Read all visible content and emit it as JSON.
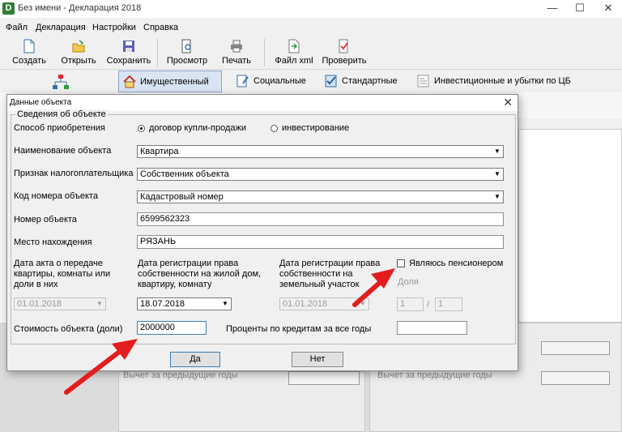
{
  "window": {
    "title": "Без имени - Декларация 2018",
    "app_icon": "D",
    "controls": [
      "—",
      "☐",
      "✕"
    ]
  },
  "menu": [
    "Файл",
    "Декларация",
    "Настройки",
    "Справка"
  ],
  "toolbar": [
    {
      "label": "Создать",
      "icon": "new-file-icon"
    },
    {
      "label": "Открыть",
      "icon": "open-folder-icon"
    },
    {
      "label": "Сохранить",
      "icon": "save-disk-icon"
    },
    {
      "label": "Просмотр",
      "icon": "preview-icon"
    },
    {
      "label": "Печать",
      "icon": "printer-icon"
    },
    {
      "label": "Файл xml",
      "icon": "xml-file-icon"
    },
    {
      "label": "Проверить",
      "icon": "check-document-icon"
    }
  ],
  "category_tabs": [
    {
      "label": "Имущественный",
      "icon": "house-icon",
      "active": true
    },
    {
      "label": "Социальные",
      "icon": "document-pen-icon"
    },
    {
      "label": "Стандартные",
      "icon": "checklist-icon"
    },
    {
      "label": "Инвестиционные и убытки по ЦБ",
      "icon": "investment-icon"
    }
  ],
  "background": {
    "deduction_prev_years_1": "Вычет за предыдущие годы",
    "deduction_prev_years_2": "Вычет за предыдущие годы"
  },
  "dialog": {
    "title": "Данные объекта",
    "close": "✕",
    "group_title": "Сведения об объекте",
    "acquisition": {
      "label": "Способ приобретения",
      "options": [
        "договор купли-продажи",
        "инвестирование"
      ],
      "selected": "договор купли-продажи"
    },
    "object_name": {
      "label": "Наименование объекта",
      "value": "Квартира"
    },
    "taxpayer_sign": {
      "label": "Признак налогоплательщика",
      "value": "Собственник объекта"
    },
    "object_code": {
      "label": "Код номера объекта",
      "value": "Кадастровый номер"
    },
    "object_number": {
      "label": "Номер объекта",
      "value": "6599562323"
    },
    "location": {
      "label": "Место нахождения",
      "value": "РЯЗАНЬ"
    },
    "transfer_act_date": {
      "label": "Дата акта о передаче квартиры, комнаты или доли в них",
      "value": "01.01.2018"
    },
    "registration_date": {
      "label": "Дата регистрации права собственности на жилой дом, квартиру, комнату",
      "value": "18.07.2018"
    },
    "land_registration_date": {
      "label": "Дата регистрации права собственности на земельный участок",
      "value": "01.01.2018"
    },
    "pensioner": {
      "label": "Являюсь пенсионером",
      "checked": false
    },
    "share": {
      "label": "Доля",
      "numerator": "1",
      "separator": "/",
      "denominator": "1"
    },
    "cost": {
      "label": "Стоимость объекта (доли)",
      "value": "2000000"
    },
    "loan_interest": {
      "label": "Проценты по кредитам за все годы",
      "value": ""
    },
    "ok_label": "Да",
    "cancel_label": "Нет"
  },
  "colors": {
    "accent_tab": "#d9e4f2",
    "annotation_arrow": "#e31d1d"
  }
}
